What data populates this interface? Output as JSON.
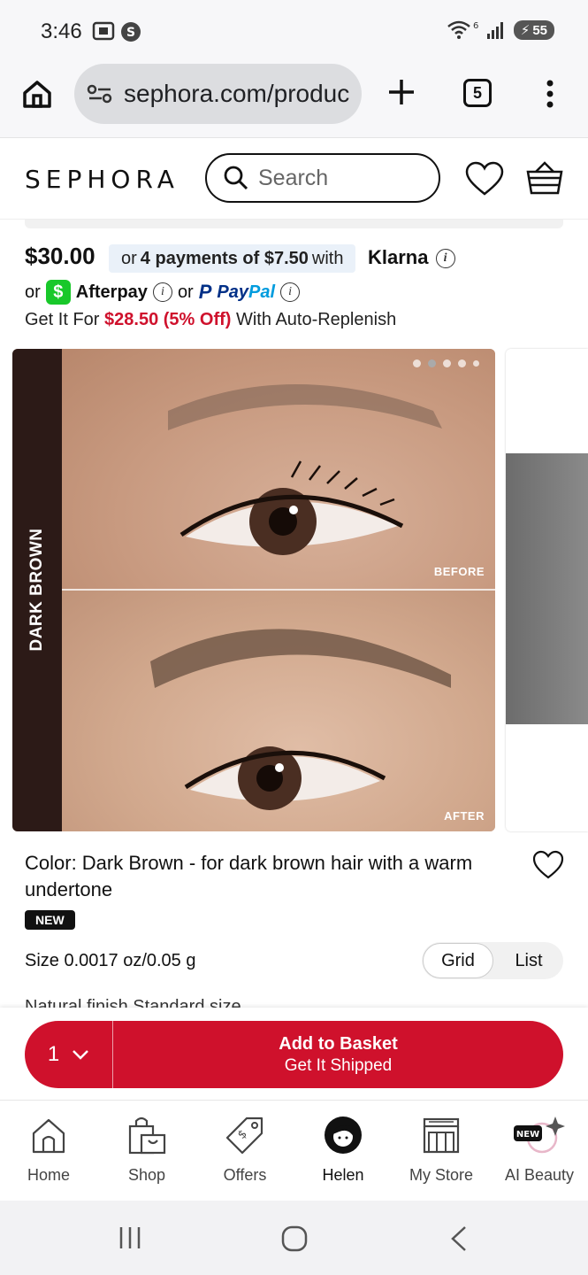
{
  "status_bar": {
    "time": "3:46",
    "battery": "55",
    "wifi_label": "6"
  },
  "browser": {
    "url": "sephora.com/produc",
    "tab_count": "5"
  },
  "header": {
    "logo": "SEPHORA",
    "search_placeholder": "Search"
  },
  "pricing": {
    "price": "$30.00",
    "klarna_prefix": "or",
    "klarna_payments": "4 payments of $7.50",
    "klarna_suffix": "with",
    "klarna_brand": "Klarna",
    "or1": "or",
    "afterpay": "Afterpay",
    "or2": "or",
    "paypal_a": "Pay",
    "paypal_b": "Pal",
    "replenish_prefix": "Get It For",
    "replenish_price": "$28.50 (5% Off)",
    "replenish_suffix": "With Auto-Replenish"
  },
  "carousel": {
    "shade_label": "DARK BROWN",
    "before_label": "BEFORE",
    "after_label": "AFTER",
    "dot_count": 5,
    "active_dot": 1
  },
  "product": {
    "color_text": "Color: Dark Brown - for dark brown hair with a warm undertone",
    "badge": "NEW",
    "size": "Size 0.0017 oz/0.05 g",
    "view_grid": "Grid",
    "view_list": "List",
    "cut_text": "Natural finish  Standard size"
  },
  "add_to_basket": {
    "qty": "1",
    "line1": "Add to Basket",
    "line2": "Get It Shipped"
  },
  "bottom_nav": [
    {
      "label": "Home",
      "icon": "home-icon"
    },
    {
      "label": "Shop",
      "icon": "shopping-bag-icon"
    },
    {
      "label": "Offers",
      "icon": "tag-icon"
    },
    {
      "label": "Helen",
      "icon": "avatar-icon"
    },
    {
      "label": "My Store",
      "icon": "store-icon"
    },
    {
      "label": "AI Beauty",
      "icon": "sparkle-icon",
      "badge": "NEW"
    }
  ],
  "colors": {
    "brand_red": "#cf112c",
    "klarna_bg": "#eaf1f9",
    "cashapp_green": "#18c82a"
  }
}
